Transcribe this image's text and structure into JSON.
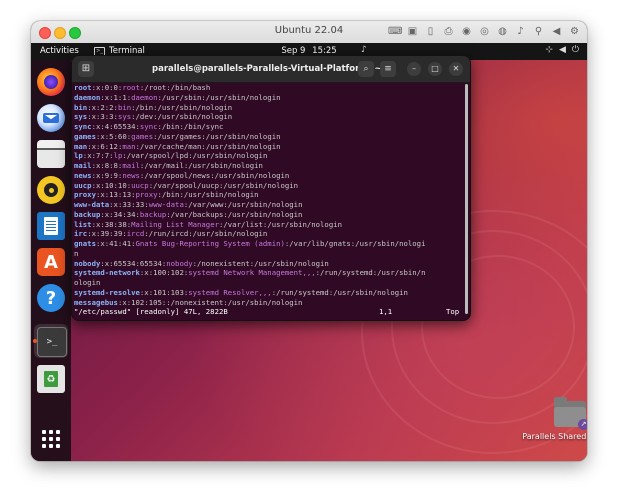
{
  "vm": {
    "title": "Ubuntu 22.04",
    "toolbar_icons": [
      "keyboard-icon",
      "sd-card-icon",
      "phone-icon",
      "printer-icon",
      "webcam-icon",
      "disk-icon",
      "microphone-icon",
      "usb-icon",
      "sound-icon",
      "settings-icon"
    ]
  },
  "topbar": {
    "activities": "Activities",
    "app_name": "Terminal",
    "date": "Sep 9",
    "time": "15:25"
  },
  "dock": {
    "items": [
      "firefox",
      "thunderbird",
      "files",
      "rhythmbox",
      "libreoffice-writer",
      "app-center",
      "help",
      "terminal",
      "trash",
      "show-applications"
    ]
  },
  "terminal": {
    "title": "parallels@parallels-Parallels-Virtual-Platform: ~",
    "lines": [
      [
        [
          "k",
          "root"
        ],
        [
          "t",
          ":x:0:0:"
        ],
        [
          "s",
          "root"
        ],
        [
          "t",
          ":/root:/bin/bash"
        ]
      ],
      [
        [
          "k",
          "daemon"
        ],
        [
          "t",
          ":x:1:1:"
        ],
        [
          "s",
          "daemon"
        ],
        [
          "t",
          ":/usr/sbin:/usr/sbin/nologin"
        ]
      ],
      [
        [
          "k",
          "bin"
        ],
        [
          "t",
          ":x:2:2:"
        ],
        [
          "s",
          "bin"
        ],
        [
          "t",
          ":/bin:/usr/sbin/nologin"
        ]
      ],
      [
        [
          "k",
          "sys"
        ],
        [
          "t",
          ":x:3:3:"
        ],
        [
          "s",
          "sys"
        ],
        [
          "t",
          ":/dev:/usr/sbin/nologin"
        ]
      ],
      [
        [
          "k",
          "sync"
        ],
        [
          "t",
          ":x:4:65534:"
        ],
        [
          "s",
          "sync"
        ],
        [
          "t",
          ":/bin:/bin/sync"
        ]
      ],
      [
        [
          "k",
          "games"
        ],
        [
          "t",
          ":x:5:60:"
        ],
        [
          "s",
          "games"
        ],
        [
          "t",
          ":/usr/games:/usr/sbin/nologin"
        ]
      ],
      [
        [
          "k",
          "man"
        ],
        [
          "t",
          ":x:6:12:"
        ],
        [
          "s",
          "man"
        ],
        [
          "t",
          ":/var/cache/man:/usr/sbin/nologin"
        ]
      ],
      [
        [
          "k",
          "lp"
        ],
        [
          "t",
          ":x:7:7:"
        ],
        [
          "s",
          "lp"
        ],
        [
          "t",
          ":/var/spool/lpd:/usr/sbin/nologin"
        ]
      ],
      [
        [
          "k",
          "mail"
        ],
        [
          "t",
          ":x:8:8:"
        ],
        [
          "s",
          "mail"
        ],
        [
          "t",
          ":/var/mail:/usr/sbin/nologin"
        ]
      ],
      [
        [
          "k",
          "news"
        ],
        [
          "t",
          ":x:9:9:"
        ],
        [
          "s",
          "news"
        ],
        [
          "t",
          ":/var/spool/news:/usr/sbin/nologin"
        ]
      ],
      [
        [
          "k",
          "uucp"
        ],
        [
          "t",
          ":x:10:10:"
        ],
        [
          "s",
          "uucp"
        ],
        [
          "t",
          ":/var/spool/uucp:/usr/sbin/nologin"
        ]
      ],
      [
        [
          "k",
          "proxy"
        ],
        [
          "t",
          ":x:13:13:"
        ],
        [
          "s",
          "proxy"
        ],
        [
          "t",
          ":/bin:/usr/sbin/nologin"
        ]
      ],
      [
        [
          "k",
          "www-data"
        ],
        [
          "t",
          ":x:33:33:"
        ],
        [
          "s",
          "www-data"
        ],
        [
          "t",
          ":/var/www:/usr/sbin/nologin"
        ]
      ],
      [
        [
          "k",
          "backup"
        ],
        [
          "t",
          ":x:34:34:"
        ],
        [
          "s",
          "backup"
        ],
        [
          "t",
          ":/var/backups:/usr/sbin/nologin"
        ]
      ],
      [
        [
          "k",
          "list"
        ],
        [
          "t",
          ":x:38:38:"
        ],
        [
          "s",
          "Mailing List Manager"
        ],
        [
          "t",
          ":/var/list:/usr/sbin/nologin"
        ]
      ],
      [
        [
          "k",
          "irc"
        ],
        [
          "t",
          ":x:39:39:"
        ],
        [
          "s",
          "ircd"
        ],
        [
          "t",
          ":/run/ircd:/usr/sbin/nologin"
        ]
      ],
      [
        [
          "k",
          "gnats"
        ],
        [
          "t",
          ":x:41:41:"
        ],
        [
          "s",
          "Gnats Bug-Reporting System (admin)"
        ],
        [
          "t",
          ":/var/lib/gnats:/usr/sbin/nologi"
        ]
      ],
      [
        [
          "t",
          "n"
        ]
      ],
      [
        [
          "k",
          "nobody"
        ],
        [
          "t",
          ":x:65534:65534:"
        ],
        [
          "s",
          "nobody"
        ],
        [
          "t",
          ":/nonexistent:/usr/sbin/nologin"
        ]
      ],
      [
        [
          "k",
          "systemd-network"
        ],
        [
          "t",
          ":x:100:102:"
        ],
        [
          "s",
          "systemd Network Management,,,"
        ],
        [
          "t",
          ":/run/systemd:/usr/sbin/n"
        ]
      ],
      [
        [
          "t",
          "ologin"
        ]
      ],
      [
        [
          "k",
          "systemd-resolve"
        ],
        [
          "t",
          ":x:101:103:"
        ],
        [
          "s",
          "systemd Resolver,,,"
        ],
        [
          "t",
          ":/run/systemd:/usr/sbin/nologin"
        ]
      ],
      [
        [
          "k",
          "messagebus"
        ],
        [
          "t",
          ":x:102:105::/nonexistent:/usr/sbin/nologin"
        ]
      ]
    ],
    "status": {
      "file": "\"/etc/passwd\" [readonly] 47L, 2822B",
      "position": "1,1",
      "scroll": "Top"
    }
  },
  "desktop": {
    "folder_label": "Parallels Shared Folders"
  },
  "colors": {
    "terminal_bg": "#300a24",
    "username": "#8ab4f8",
    "gecos": "#c678dd",
    "ubuntu_orange": "#e95420"
  }
}
